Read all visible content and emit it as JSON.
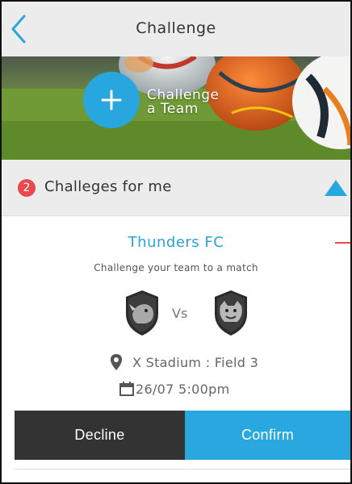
{
  "header": {
    "title": "Challenge",
    "back_icon": "chevron-left-icon"
  },
  "hero": {
    "action_icon": "plus-icon",
    "label_line1": "Challenge",
    "label_line2": "a Team"
  },
  "section": {
    "badge_count": "2",
    "title": "Challeges for me",
    "toggle_icon": "triangle-up-icon"
  },
  "challenge": {
    "team_name": "Thunders FC",
    "subtitle": "Challenge your team to a match",
    "vs_label": "Vs",
    "location_icon": "map-pin-icon",
    "location": "X Stadium : Field 3",
    "date_icon": "calendar-icon",
    "datetime": "26/07  5:00pm",
    "decline_label": "Decline",
    "confirm_label": "Confirm"
  },
  "colors": {
    "accent": "#29a8e0",
    "badge": "#e84a50",
    "dark_button": "#333333",
    "header_bg": "#ececec"
  }
}
